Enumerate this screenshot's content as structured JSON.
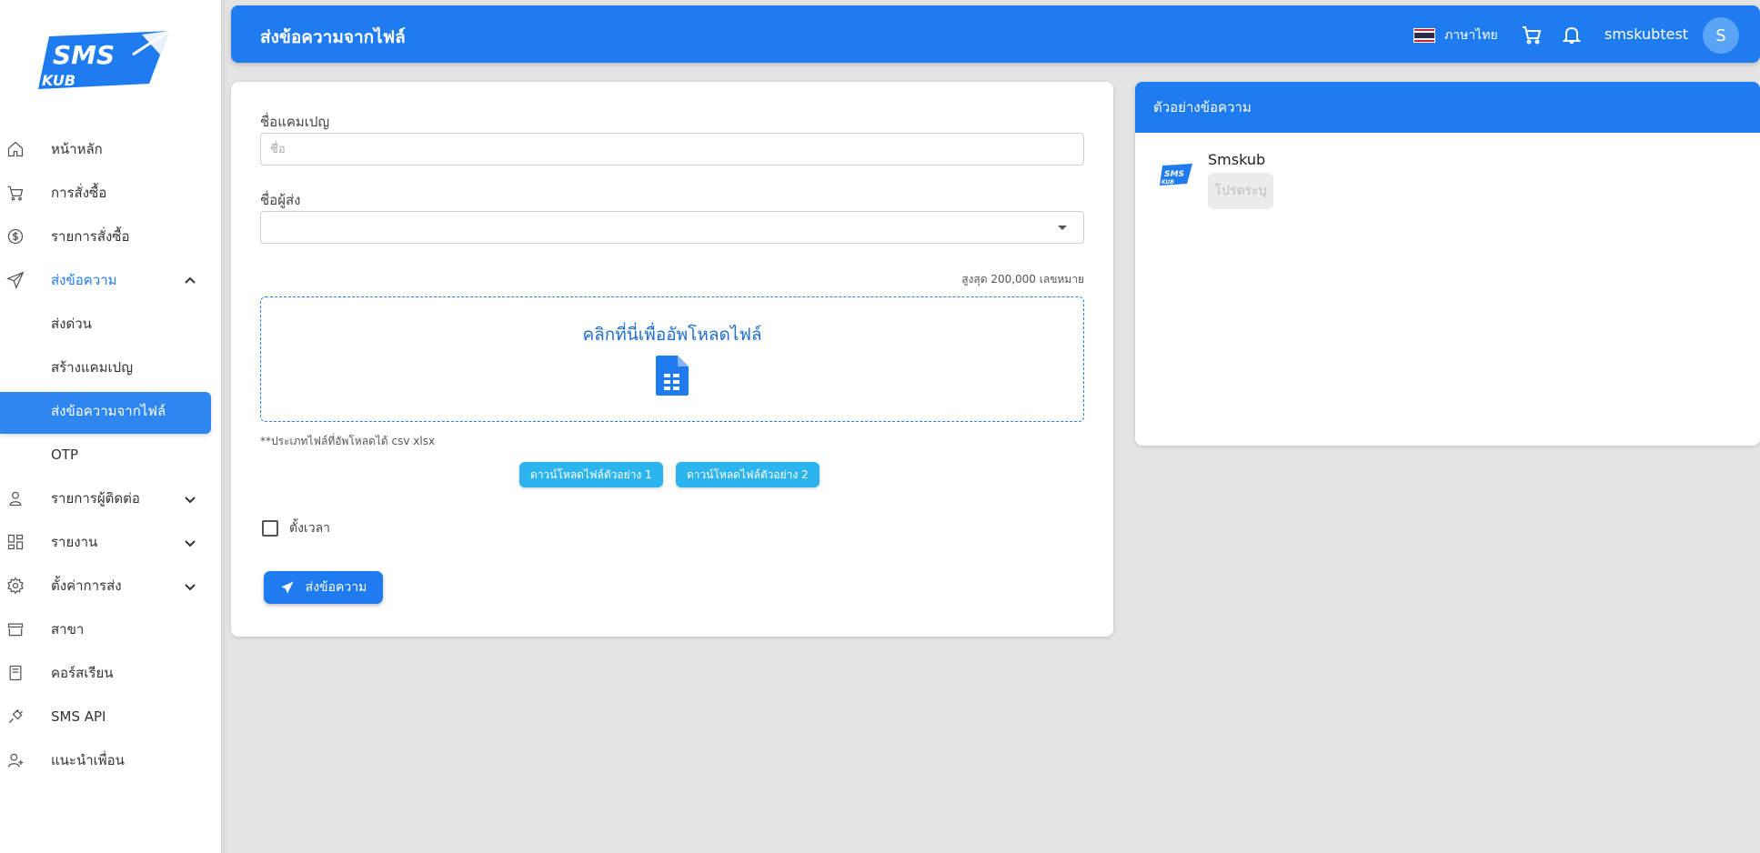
{
  "brand": {
    "logo_top": "SMS",
    "logo_bottom": "KUB",
    "color": "#1e7cf0"
  },
  "sidebar": {
    "items": [
      {
        "label": "หน้าหลัก",
        "icon": "home-icon"
      },
      {
        "label": "การสั่งซื้อ",
        "icon": "cart-icon"
      },
      {
        "label": "รายการสั่งซื้อ",
        "icon": "dollar-circle-icon"
      },
      {
        "label": "ส่งข้อความ",
        "icon": "send-icon",
        "expanded": true
      },
      {
        "label": "ส่งด่วน"
      },
      {
        "label": "สร้างแคมเปญ"
      },
      {
        "label": "ส่งข้อความจากไฟล์",
        "active": true
      },
      {
        "label": "OTP"
      },
      {
        "label": "รายการผู้ติดต่อ",
        "icon": "user-icon"
      },
      {
        "label": "รายงาน",
        "icon": "dashboard-icon"
      },
      {
        "label": "ตั้งค่าการส่ง",
        "icon": "gear-icon"
      },
      {
        "label": "สาขา",
        "icon": "store-icon"
      },
      {
        "label": "คอร์สเรียน",
        "icon": "book-icon"
      },
      {
        "label": "SMS API",
        "icon": "plug-icon"
      },
      {
        "label": "แนะนำเพื่อน",
        "icon": "user-add-icon"
      }
    ]
  },
  "header": {
    "title": "ส่งข้อความจากไฟล์",
    "language": "ภาษาไทย",
    "username": "smskubtest",
    "avatar_letter": "S"
  },
  "form": {
    "campaign_label": "ชื่อแคมเปญ",
    "campaign_placeholder": "ชื่อ",
    "campaign_value": "",
    "sender_label": "ชื่อผู้ส่ง",
    "sender_value": "",
    "max_note": "สูงสุด 200,000 เลขหมาย",
    "upload_text": "คลิกที่นี่เพื่ออัพโหลดไฟล์",
    "file_types": "**ประเภทไฟล์ที่อัพโหลดได้ csv xlsx",
    "download_sample_1": "ดาวน์โหลดไฟล์ตัวอย่าง 1",
    "download_sample_2": "ดาวน์โหลดไฟล์ตัวอย่าง 2",
    "schedule_label": "ตั้งเวลา",
    "schedule_checked": false,
    "send_button": "ส่งข้อความ"
  },
  "preview": {
    "title": "ตัวอย่างข้อความ",
    "sender": "Smskub",
    "message_placeholder": "โปรดระบุ"
  }
}
